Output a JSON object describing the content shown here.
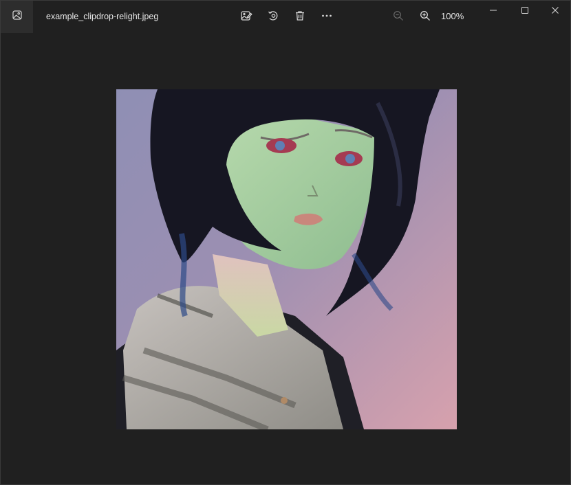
{
  "app": {
    "icon": "photos-app-icon"
  },
  "file": {
    "name": "example_clipdrop-relight.jpeg"
  },
  "toolbar": {
    "edit_icon": "edit-image-icon",
    "rotate_icon": "rotate-icon",
    "delete_icon": "delete-icon",
    "more_icon": "more-options-icon",
    "zoom_out_icon": "zoom-out-icon",
    "zoom_in_icon": "zoom-in-icon",
    "zoom_level": "100%"
  },
  "window_controls": {
    "minimize_icon": "minimize-icon",
    "maximize_icon": "maximize-icon",
    "close_icon": "close-icon"
  },
  "colors": {
    "background": "#202020",
    "text": "#e8e8e8",
    "icon": "#d6d6d6",
    "icon_disabled": "#6b6b6b"
  }
}
